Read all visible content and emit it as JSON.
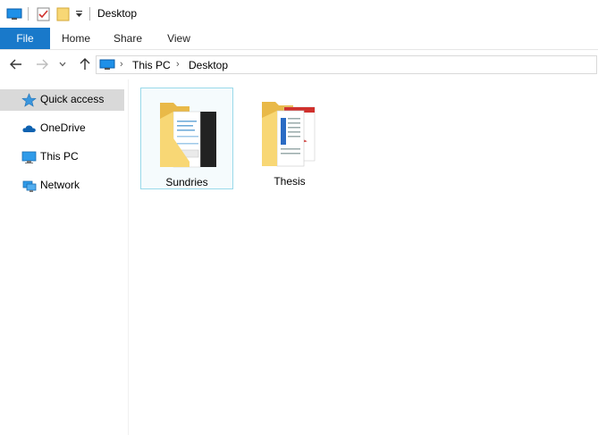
{
  "window": {
    "title": "Desktop"
  },
  "ribbon": {
    "tabs": [
      {
        "label": "File"
      },
      {
        "label": "Home"
      },
      {
        "label": "Share"
      },
      {
        "label": "View"
      }
    ]
  },
  "address": {
    "crumbs": [
      "This PC",
      "Desktop"
    ]
  },
  "navpane": {
    "items": [
      {
        "label": "Quick access",
        "icon": "star-icon",
        "selected": true
      },
      {
        "label": "OneDrive",
        "icon": "cloud-icon"
      },
      {
        "label": "This PC",
        "icon": "monitor-icon"
      },
      {
        "label": "Network",
        "icon": "network-icon"
      }
    ]
  },
  "content": {
    "folders": [
      {
        "label": "Sundries",
        "selected": true
      },
      {
        "label": "Thesis"
      }
    ]
  },
  "colors": {
    "file_tab": "#1979ca",
    "selection_border": "#99d9ea",
    "folder": "#f8d775"
  }
}
